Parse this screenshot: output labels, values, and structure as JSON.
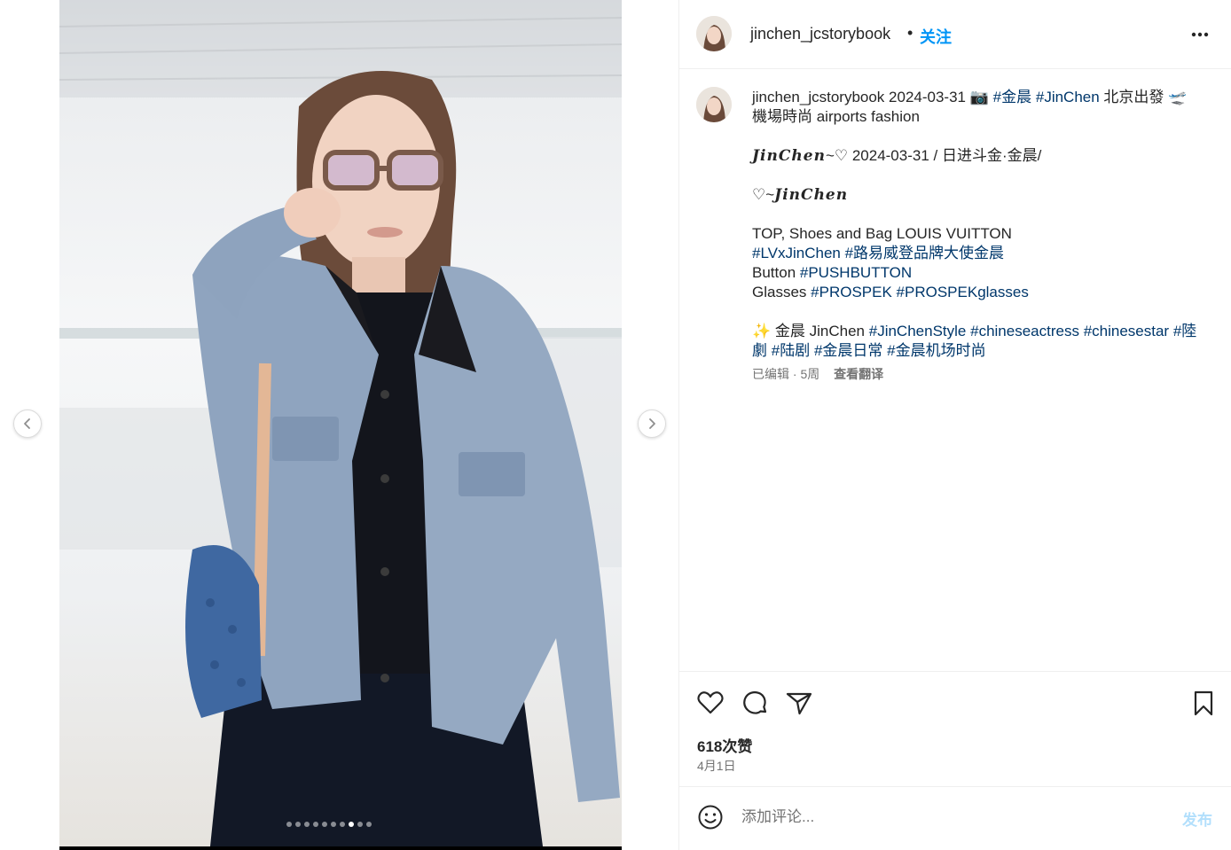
{
  "post": {
    "author": "jinchen_jcstorybook",
    "follow_label": "关注",
    "separator": "•"
  },
  "media": {
    "slide_count": 10,
    "active_slide": 8
  },
  "caption": {
    "username": "jinchen_jcstorybook",
    "date": "2024-03-31",
    "camera_emoji": "📷",
    "tag_jinchen_cn": "#金晨",
    "tag_jinchen": "#JinChen",
    "depart_text": "北京出發",
    "plane_emoji": "🛫",
    "fashion_text": "機場時尚 airports fashion",
    "script_name_1": "JinChen",
    "line2_rest": "~♡ 2024-03-31 / 日进斗金·金晨/",
    "line3_prefix": "♡~",
    "script_name_2": "JinChen",
    "brand_line": "TOP, Shoes and Bag LOUIS VUITTON",
    "tag_lv": "#LVxJinChen",
    "tag_lv_cn": "#路易威登品牌大使金晨",
    "button_label": "Button",
    "tag_pushbutton": "#PUSHBUTTON",
    "glasses_label": "Glasses",
    "tag_prospek": "#PROSPEK",
    "tag_prospekglasses": "#PROSPEKglasses",
    "sparkle_emoji": "✨",
    "name_text": "金晨 JinChen",
    "tag_style": "#JinChenStyle",
    "tag_actress": "#chineseactress",
    "tag_star": "#chinesestar",
    "tag_luju_trad": "#陸劇",
    "tag_luju": "#陆剧",
    "tag_daily": "#金晨日常",
    "tag_airport": "#金晨机场时尚",
    "edited": "已编辑 · 5周",
    "translate_label": "查看翻译"
  },
  "engagement": {
    "likes": "618次赞",
    "date": "4月1日"
  },
  "comment": {
    "placeholder": "添加评论...",
    "post_label": "发布"
  },
  "colors": {
    "link": "#00376b",
    "follow": "#0095f6",
    "post_disabled": "#b2dffc",
    "muted": "#737373",
    "border": "#efefef"
  },
  "icons": [
    "chevron-left-icon",
    "chevron-right-icon",
    "more-icon",
    "heart-icon",
    "comment-icon",
    "share-icon",
    "bookmark-icon",
    "emoji-icon"
  ]
}
